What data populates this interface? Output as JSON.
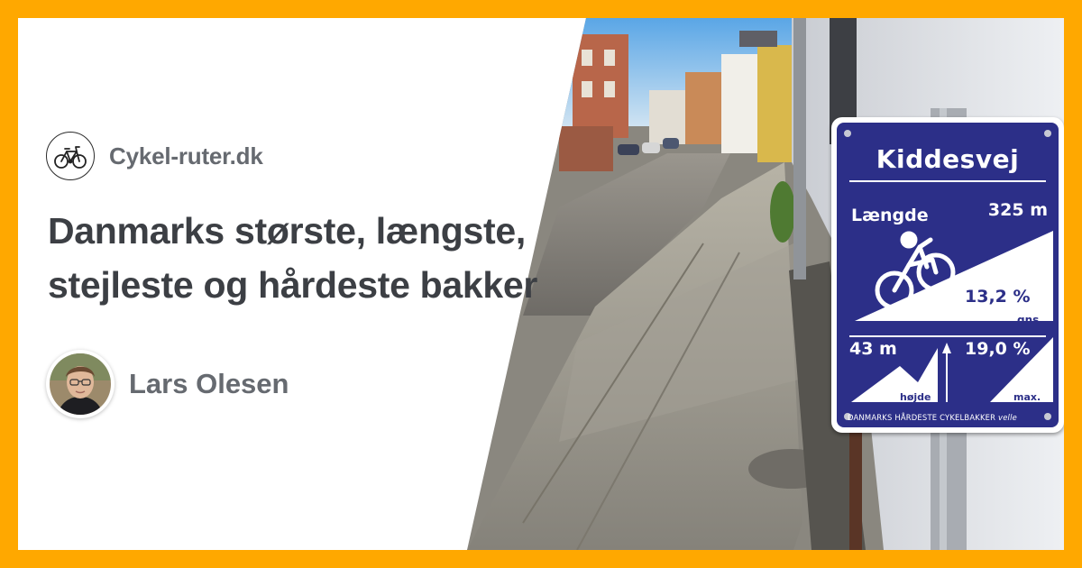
{
  "brand": {
    "name": "Cykel-ruter.dk",
    "logo_icon": "bicycle-icon"
  },
  "article": {
    "headline_line1": "Danmarks største, længste,",
    "headline_line2": "stejleste og hårdeste bakker"
  },
  "author": {
    "name": "Lars Olesen",
    "avatar_icon": "person-portrait-icon"
  },
  "sign": {
    "title": "Kiddesvej",
    "length_label": "Længde",
    "length_value": "325 m",
    "avg_grade": "13,2 %",
    "avg_label": "gns.",
    "height_value": "43 m",
    "height_label": "højde",
    "max_grade": "19,0 %",
    "max_label": "max.",
    "footer": "DANMARKS HÅRDESTE CYKELBAKKER",
    "footer_logo": "velle"
  },
  "colors": {
    "frame": "#ffa800",
    "sign_blue": "#2c2f88",
    "headline": "#3c3f44",
    "muted": "#666a70"
  }
}
